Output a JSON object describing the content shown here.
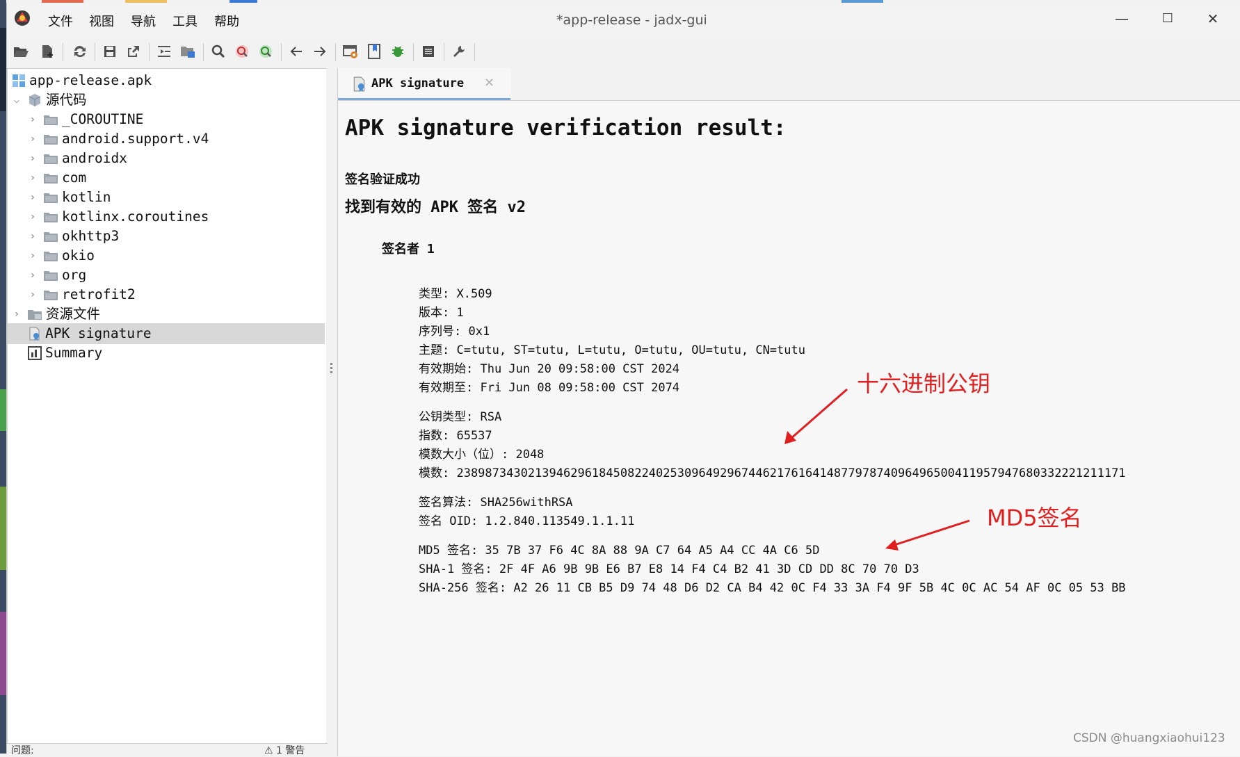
{
  "window": {
    "title": "*app-release - jadx-gui",
    "menu": [
      "文件",
      "视图",
      "导航",
      "工具",
      "帮助"
    ],
    "controls": [
      "—",
      "☐",
      "✕"
    ]
  },
  "toolbar": {
    "icons": [
      "open-file-icon",
      "add-files-icon",
      "sync-icon",
      "save-all-icon",
      "export-icon",
      "expand-icon",
      "folder-tree-icon",
      "search-icon",
      "find-class-icon",
      "find-usage-icon",
      "back-icon",
      "forward-icon",
      "decompile-all-icon",
      "bookmark-icon",
      "debug-icon",
      "log-icon",
      "preferences-icon"
    ]
  },
  "tree": {
    "root": "app-release.apk",
    "source_label": "源代码",
    "packages": [
      "_COROUTINE",
      "android.support.v4",
      "androidx",
      "com",
      "kotlin",
      "kotlinx.coroutines",
      "okhttp3",
      "okio",
      "org",
      "retrofit2"
    ],
    "resources_label": "资源文件",
    "apk_signature_label": "APK signature",
    "summary_label": "Summary"
  },
  "status": {
    "left": "问题:",
    "right": "⚠ 1 警告"
  },
  "tab": {
    "label": "APK signature",
    "close": "×"
  },
  "signature": {
    "heading": "APK signature verification result:",
    "status": "签名验证成功",
    "found": "找到有效的 APK 签名 v2",
    "signer": "签名者 1",
    "cert_lines": [
      "类型: X.509",
      "版本: 1",
      "序列号: 0x1",
      "主题: C=tutu, ST=tutu, L=tutu, O=tutu, OU=tutu, CN=tutu",
      "有效期始: Thu Jun 20 09:58:00 CST 2024",
      "有效期至: Fri Jun 08 09:58:00 CST 2074"
    ],
    "key_lines": [
      "公钥类型: RSA",
      "指数: 65537",
      "模数大小（位）: 2048",
      "模数: 2389873430213946296184508224025309649296744621761641487797874096496500411957947680332221211171"
    ],
    "algo_lines": [
      "签名算法: SHA256withRSA",
      "签名 OID: 1.2.840.113549.1.1.11"
    ],
    "digest_lines": [
      "MD5 签名: 35 7B 37 F6 4C 8A 88 9A C7 64 A5 A4 CC 4A C6 5D",
      "SHA-1 签名: 2F 4F A6 9B 9B E6 B7 E8 14 F4 C4 B2 41 3D CD DD 8C 70 70 D3",
      "SHA-256 签名: A2 26 11 CB B5 D9 74 48 D6 D2 CA B4 42 0C F4 33 3A F4 9F 5B 4C 0C AC 54 AF 0C 05 53 BB"
    ]
  },
  "annotations": {
    "hex_public_key": "十六进制公钥",
    "md5_signature": "MD5签名",
    "color": "#e02020"
  },
  "watermark": "CSDN @huangxiaohui123"
}
